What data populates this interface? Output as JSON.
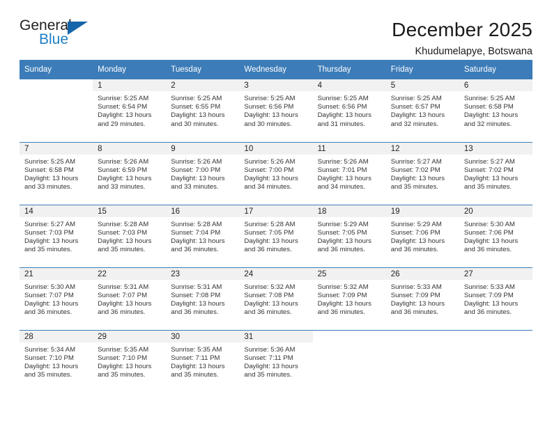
{
  "logo": {
    "word_one": "General",
    "word_two": "Blue",
    "triangle_color": "#1565a8",
    "blue_text_color": "#1f7fc4"
  },
  "header": {
    "title": "December 2025",
    "subtitle": "Khudumelapye, Botswana"
  },
  "theme": {
    "header_row_bg": "#3c7cb8",
    "daynum_bg": "#f1f1f1",
    "grid_line": "#3c7cb8"
  },
  "weekday_headers": [
    "Sunday",
    "Monday",
    "Tuesday",
    "Wednesday",
    "Thursday",
    "Friday",
    "Saturday"
  ],
  "weeks": [
    [
      {
        "day": "",
        "sunrise": "",
        "sunset": "",
        "daylight_line1": "",
        "daylight_line2": ""
      },
      {
        "day": "1",
        "sunrise": "Sunrise: 5:25 AM",
        "sunset": "Sunset: 6:54 PM",
        "daylight_line1": "Daylight: 13 hours",
        "daylight_line2": "and 29 minutes."
      },
      {
        "day": "2",
        "sunrise": "Sunrise: 5:25 AM",
        "sunset": "Sunset: 6:55 PM",
        "daylight_line1": "Daylight: 13 hours",
        "daylight_line2": "and 30 minutes."
      },
      {
        "day": "3",
        "sunrise": "Sunrise: 5:25 AM",
        "sunset": "Sunset: 6:56 PM",
        "daylight_line1": "Daylight: 13 hours",
        "daylight_line2": "and 30 minutes."
      },
      {
        "day": "4",
        "sunrise": "Sunrise: 5:25 AM",
        "sunset": "Sunset: 6:56 PM",
        "daylight_line1": "Daylight: 13 hours",
        "daylight_line2": "and 31 minutes."
      },
      {
        "day": "5",
        "sunrise": "Sunrise: 5:25 AM",
        "sunset": "Sunset: 6:57 PM",
        "daylight_line1": "Daylight: 13 hours",
        "daylight_line2": "and 32 minutes."
      },
      {
        "day": "6",
        "sunrise": "Sunrise: 5:25 AM",
        "sunset": "Sunset: 6:58 PM",
        "daylight_line1": "Daylight: 13 hours",
        "daylight_line2": "and 32 minutes."
      }
    ],
    [
      {
        "day": "7",
        "sunrise": "Sunrise: 5:25 AM",
        "sunset": "Sunset: 6:58 PM",
        "daylight_line1": "Daylight: 13 hours",
        "daylight_line2": "and 33 minutes."
      },
      {
        "day": "8",
        "sunrise": "Sunrise: 5:26 AM",
        "sunset": "Sunset: 6:59 PM",
        "daylight_line1": "Daylight: 13 hours",
        "daylight_line2": "and 33 minutes."
      },
      {
        "day": "9",
        "sunrise": "Sunrise: 5:26 AM",
        "sunset": "Sunset: 7:00 PM",
        "daylight_line1": "Daylight: 13 hours",
        "daylight_line2": "and 33 minutes."
      },
      {
        "day": "10",
        "sunrise": "Sunrise: 5:26 AM",
        "sunset": "Sunset: 7:00 PM",
        "daylight_line1": "Daylight: 13 hours",
        "daylight_line2": "and 34 minutes."
      },
      {
        "day": "11",
        "sunrise": "Sunrise: 5:26 AM",
        "sunset": "Sunset: 7:01 PM",
        "daylight_line1": "Daylight: 13 hours",
        "daylight_line2": "and 34 minutes."
      },
      {
        "day": "12",
        "sunrise": "Sunrise: 5:27 AM",
        "sunset": "Sunset: 7:02 PM",
        "daylight_line1": "Daylight: 13 hours",
        "daylight_line2": "and 35 minutes."
      },
      {
        "day": "13",
        "sunrise": "Sunrise: 5:27 AM",
        "sunset": "Sunset: 7:02 PM",
        "daylight_line1": "Daylight: 13 hours",
        "daylight_line2": "and 35 minutes."
      }
    ],
    [
      {
        "day": "14",
        "sunrise": "Sunrise: 5:27 AM",
        "sunset": "Sunset: 7:03 PM",
        "daylight_line1": "Daylight: 13 hours",
        "daylight_line2": "and 35 minutes."
      },
      {
        "day": "15",
        "sunrise": "Sunrise: 5:28 AM",
        "sunset": "Sunset: 7:03 PM",
        "daylight_line1": "Daylight: 13 hours",
        "daylight_line2": "and 35 minutes."
      },
      {
        "day": "16",
        "sunrise": "Sunrise: 5:28 AM",
        "sunset": "Sunset: 7:04 PM",
        "daylight_line1": "Daylight: 13 hours",
        "daylight_line2": "and 36 minutes."
      },
      {
        "day": "17",
        "sunrise": "Sunrise: 5:28 AM",
        "sunset": "Sunset: 7:05 PM",
        "daylight_line1": "Daylight: 13 hours",
        "daylight_line2": "and 36 minutes."
      },
      {
        "day": "18",
        "sunrise": "Sunrise: 5:29 AM",
        "sunset": "Sunset: 7:05 PM",
        "daylight_line1": "Daylight: 13 hours",
        "daylight_line2": "and 36 minutes."
      },
      {
        "day": "19",
        "sunrise": "Sunrise: 5:29 AM",
        "sunset": "Sunset: 7:06 PM",
        "daylight_line1": "Daylight: 13 hours",
        "daylight_line2": "and 36 minutes."
      },
      {
        "day": "20",
        "sunrise": "Sunrise: 5:30 AM",
        "sunset": "Sunset: 7:06 PM",
        "daylight_line1": "Daylight: 13 hours",
        "daylight_line2": "and 36 minutes."
      }
    ],
    [
      {
        "day": "21",
        "sunrise": "Sunrise: 5:30 AM",
        "sunset": "Sunset: 7:07 PM",
        "daylight_line1": "Daylight: 13 hours",
        "daylight_line2": "and 36 minutes."
      },
      {
        "day": "22",
        "sunrise": "Sunrise: 5:31 AM",
        "sunset": "Sunset: 7:07 PM",
        "daylight_line1": "Daylight: 13 hours",
        "daylight_line2": "and 36 minutes."
      },
      {
        "day": "23",
        "sunrise": "Sunrise: 5:31 AM",
        "sunset": "Sunset: 7:08 PM",
        "daylight_line1": "Daylight: 13 hours",
        "daylight_line2": "and 36 minutes."
      },
      {
        "day": "24",
        "sunrise": "Sunrise: 5:32 AM",
        "sunset": "Sunset: 7:08 PM",
        "daylight_line1": "Daylight: 13 hours",
        "daylight_line2": "and 36 minutes."
      },
      {
        "day": "25",
        "sunrise": "Sunrise: 5:32 AM",
        "sunset": "Sunset: 7:09 PM",
        "daylight_line1": "Daylight: 13 hours",
        "daylight_line2": "and 36 minutes."
      },
      {
        "day": "26",
        "sunrise": "Sunrise: 5:33 AM",
        "sunset": "Sunset: 7:09 PM",
        "daylight_line1": "Daylight: 13 hours",
        "daylight_line2": "and 36 minutes."
      },
      {
        "day": "27",
        "sunrise": "Sunrise: 5:33 AM",
        "sunset": "Sunset: 7:09 PM",
        "daylight_line1": "Daylight: 13 hours",
        "daylight_line2": "and 36 minutes."
      }
    ],
    [
      {
        "day": "28",
        "sunrise": "Sunrise: 5:34 AM",
        "sunset": "Sunset: 7:10 PM",
        "daylight_line1": "Daylight: 13 hours",
        "daylight_line2": "and 35 minutes."
      },
      {
        "day": "29",
        "sunrise": "Sunrise: 5:35 AM",
        "sunset": "Sunset: 7:10 PM",
        "daylight_line1": "Daylight: 13 hours",
        "daylight_line2": "and 35 minutes."
      },
      {
        "day": "30",
        "sunrise": "Sunrise: 5:35 AM",
        "sunset": "Sunset: 7:11 PM",
        "daylight_line1": "Daylight: 13 hours",
        "daylight_line2": "and 35 minutes."
      },
      {
        "day": "31",
        "sunrise": "Sunrise: 5:36 AM",
        "sunset": "Sunset: 7:11 PM",
        "daylight_line1": "Daylight: 13 hours",
        "daylight_line2": "and 35 minutes."
      },
      {
        "day": "",
        "sunrise": "",
        "sunset": "",
        "daylight_line1": "",
        "daylight_line2": ""
      },
      {
        "day": "",
        "sunrise": "",
        "sunset": "",
        "daylight_line1": "",
        "daylight_line2": ""
      },
      {
        "day": "",
        "sunrise": "",
        "sunset": "",
        "daylight_line1": "",
        "daylight_line2": ""
      }
    ]
  ]
}
